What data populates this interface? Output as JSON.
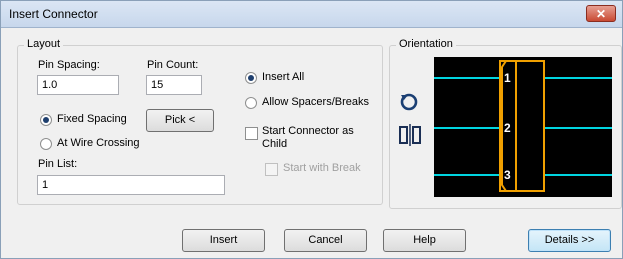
{
  "window": {
    "title": "Insert Connector",
    "close_glyph": "✕"
  },
  "layout": {
    "group_label": "Layout",
    "pin_spacing": {
      "label": "Pin Spacing:",
      "value": "1.0"
    },
    "pin_count": {
      "label": "Pin Count:",
      "value": "15"
    },
    "fixed_spacing_label": "Fixed Spacing",
    "at_wire_crossing_label": "At Wire Crossing",
    "pick_label": "Pick <",
    "pin_list": {
      "label": "Pin List:",
      "value": "1"
    },
    "insert_all_label": "Insert All",
    "allow_spacers_label": "Allow Spacers/Breaks",
    "start_child_label_1": "Start Connector as",
    "start_child_label_2": "Child",
    "start_break_label": "Start with Break",
    "fixed_spacing_selected": true,
    "insert_all_selected": true
  },
  "orientation": {
    "group_label": "Orientation",
    "pins": [
      "1",
      "2",
      "3"
    ],
    "rotate_icon": "rotate-icon",
    "flip_icon": "flip-icon",
    "colors": {
      "wire": "#00d5e0",
      "connector": "#f0a000",
      "background": "#000000"
    }
  },
  "buttons": {
    "insert": "Insert",
    "cancel": "Cancel",
    "help": "Help",
    "details": "Details >>"
  }
}
